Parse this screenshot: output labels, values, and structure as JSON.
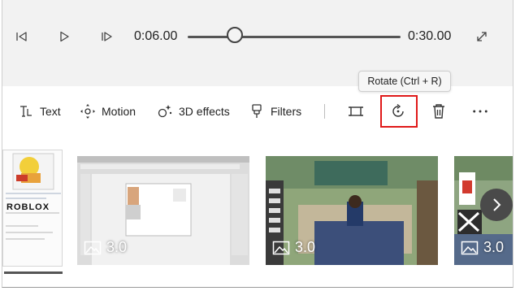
{
  "playback": {
    "current_time": "0:06.00",
    "total_time": "0:30.00",
    "progress": 0.2,
    "buttons": {
      "prev_frame": "skip-back-icon",
      "play": "play-icon",
      "next_frame": "skip-forward-icon",
      "fullscreen": "expand-icon"
    }
  },
  "tooltip": {
    "text": "Rotate (Ctrl + R)"
  },
  "toolbar": {
    "text_label": "Text",
    "motion_label": "Motion",
    "effects_label": "3D effects",
    "filters_label": "Filters",
    "highlight_color": "#e01919"
  },
  "storyboard": {
    "cards": [
      {
        "duration": "",
        "logo_text": "ROBLOX"
      },
      {
        "duration": "3.0"
      },
      {
        "duration": "3.0"
      },
      {
        "duration": "3.0"
      }
    ]
  }
}
